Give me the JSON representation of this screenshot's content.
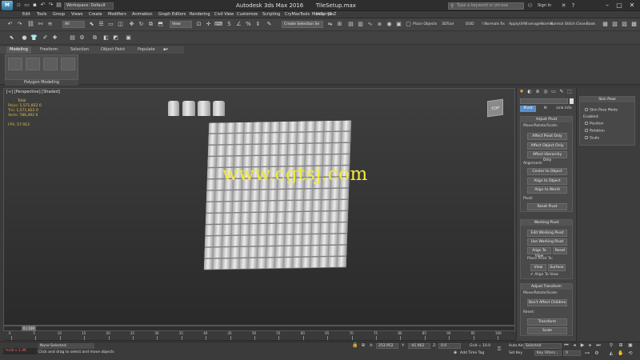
{
  "titlebar": {
    "workspace_label": "Workspace: Default",
    "app_name": "Autodesk 3ds Max 2016",
    "file_name": "TileSetup.max",
    "search_placeholder": "Type a keyword or phrase",
    "signin_label": "Sign In"
  },
  "menubar": {
    "items": [
      "Edit",
      "Tools",
      "Group",
      "Views",
      "Create",
      "Modifiers",
      "Animation",
      "Graph Editors",
      "Rendering",
      "Civil View",
      "Customize",
      "Scripting",
      "CryMaxTools",
      "MaxScript",
      "Help",
      "GoZ"
    ]
  },
  "toolbar": {
    "selection_filter": "All",
    "reference_coord": "View",
    "named_selection": "Create Selection Se",
    "extra_labels": [
      "Place Objects",
      "3DTool",
      "DOD",
      "!:Normals fix",
      "ApplyUVW",
      "verageNorms",
      "Normal Stitch",
      "CleanBook"
    ]
  },
  "ribbon": {
    "tabs": [
      "Modeling",
      "Freeform",
      "Selection",
      "Object Paint",
      "Populate"
    ],
    "panel_label": "Polygon Modeling"
  },
  "viewport": {
    "label": "[+] [Perspective] [Shaded]",
    "stats": {
      "total_label": "Total",
      "polys_label": "Polys:",
      "polys_value": "1,571,822",
      "polys_sel": "0",
      "tris_label": "Tris:",
      "tris_value": "1,571,822",
      "tris_sel": "0",
      "verts_label": "Verts:",
      "verts_value": "786,492",
      "verts_sel": "0",
      "fps_label": "FPS:",
      "fps_value": "57.913"
    },
    "viewcube_label": "TOP",
    "watermark": "www.cgtsj.com"
  },
  "command_panel": {
    "subtabs": [
      "Pivot",
      "IK",
      "Link Info"
    ],
    "adjust_pivot": {
      "title": "Adjust Pivot",
      "move_label": "Move/Rotate/Scale:",
      "buttons": [
        "Affect Pivot Only",
        "Affect Object Only",
        "Affect Hierarchy Only"
      ],
      "alignment_label": "Alignment:",
      "align_buttons": [
        "Center to Object",
        "Align to Object",
        "Align to World"
      ],
      "pivot_label": "Pivot:",
      "reset_button": "Reset Pivot"
    },
    "working_pivot": {
      "title": "Working Pivot",
      "buttons": [
        "Edit Working Pivot",
        "Use Working Pivot"
      ],
      "align_view": "Align To View",
      "reset": "Reset",
      "place_label": "Place Pivot To:",
      "view_btn": "View",
      "surface_btn": "Surface",
      "align_to_view_check": "Align To View"
    },
    "adjust_transform": {
      "title": "Adjust Transform",
      "move_label": "Move/Rotate/Scale:",
      "dont_affect": "Don't Affect Children",
      "reset_label": "Reset:",
      "transform_btn": "Transform",
      "scale_btn": "Scale"
    }
  },
  "skin_pose": {
    "title": "Skin Pose",
    "skin_pose_mode": "Skin Pose Mode",
    "enabled_label": "Enabled:",
    "position": "Position",
    "rotation": "Rotation",
    "scale": "Scale"
  },
  "timeline": {
    "frame_label": "0 / 100",
    "ticks": [
      "0",
      "5",
      "10",
      "15",
      "20",
      "25",
      "30",
      "35",
      "40",
      "45",
      "50",
      "55",
      "60",
      "65",
      "70",
      "75",
      "80",
      "85",
      "90",
      "95",
      "100"
    ]
  },
  "status": {
    "maxscript": "*si.lb v 1.46",
    "selection": "None Selected",
    "prompt": "Click and drag to select and move objects",
    "x_label": "X:",
    "x_value": "253.952",
    "y_label": "Y:",
    "y_value": "-41.962",
    "z_label": "Z:",
    "z_value": "0.0",
    "grid": "Grid = 10.0",
    "add_time_tag": "Add Time Tag",
    "auto_key": "Auto Key",
    "auto_key_value": "Selected",
    "set_key": "Set Key",
    "key_filters": "Key Filters...",
    "frame_value": "0"
  }
}
